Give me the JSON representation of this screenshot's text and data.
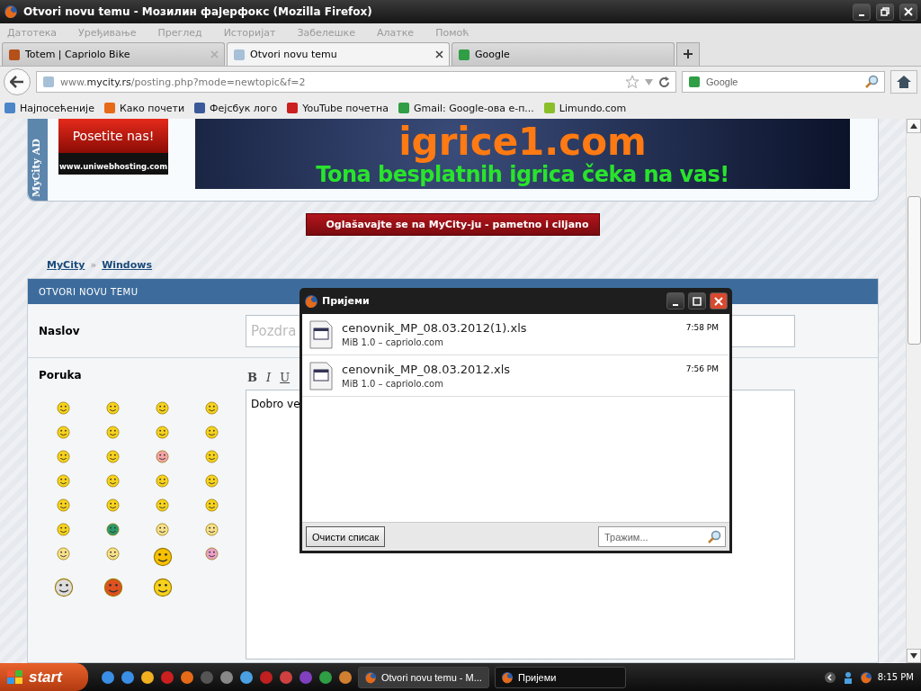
{
  "window": {
    "title": "Otvori novu temu - Мозилин фајерфокс (Mozilla Firefox)"
  },
  "menu": [
    "Датотека",
    "Уређивање",
    "Преглед",
    "Историјат",
    "Забелешке",
    "Алатке",
    "Помоћ"
  ],
  "tabs": [
    {
      "label": "Totem | Capriolo Bike",
      "selected": false
    },
    {
      "label": "Otvori novu temu",
      "selected": true
    },
    {
      "label": "Google",
      "selected": false
    }
  ],
  "address": {
    "prefix": "www.",
    "domain": "mycity.rs",
    "path": "/posting.php?mode=newtopic&f=2"
  },
  "search": {
    "placeholder": "Google"
  },
  "bookmarks": [
    "Најпосећеније",
    "Како почети",
    "Фејсбук лого",
    "YouTube почетна",
    "Gmail: Google-ова е-п...",
    "Limundo.com"
  ],
  "ads": {
    "side_label": "MyCity AD",
    "button": "Posetite nas!",
    "host": "www.uniwebhosting.com",
    "banner_title": "igrice1.com",
    "banner_text": "Tona besplatnih igrica čeka na vas!",
    "advertise": "Oglašavajte se na MyCity-ju - pametno i ciljano"
  },
  "breadcrumb": [
    "MyCity",
    "Windows"
  ],
  "breadcrumb_separator": "»",
  "form": {
    "header": "OTVORI NOVU TEMU",
    "subject_label": "Naslov",
    "subject_value": "Pozdra",
    "message_label": "Poruka",
    "toolbar": [
      "B",
      "I",
      "U"
    ],
    "message_value": "Dobro ve"
  },
  "downloads": {
    "title": "Пријеми",
    "items": [
      {
        "name": "cenovnik_MP_08.03.2012(1).xls",
        "info": "MiB 1.0 – capriolo.com",
        "time": "7:58 PM"
      },
      {
        "name": "cenovnik_MP_08.03.2012.xls",
        "info": "MiB 1.0 – capriolo.com",
        "time": "7:56 PM"
      }
    ],
    "clear_button": "Очисти списак",
    "search_placeholder": "Тражим..."
  },
  "taskbar": {
    "start": "start",
    "tasks": [
      {
        "label": "Otvori novu temu - M...",
        "selected": false
      },
      {
        "label": "Пријеми",
        "selected": true
      }
    ],
    "clock": "8:15 PM"
  }
}
